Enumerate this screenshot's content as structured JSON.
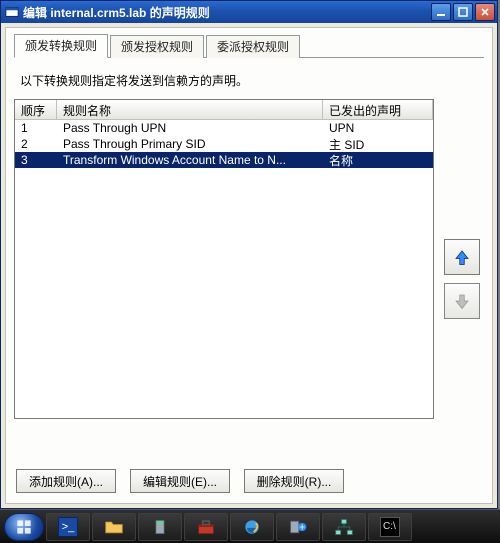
{
  "window": {
    "title": "编辑 internal.crm5.lab 的声明规则"
  },
  "tabs": [
    {
      "label": "颁发转换规则",
      "active": true
    },
    {
      "label": "颁发授权规则",
      "active": false
    },
    {
      "label": "委派授权规则",
      "active": false
    }
  ],
  "description": "以下转换规则指定将发送到信赖方的声明。",
  "list": {
    "headers": {
      "order": "顺序",
      "name": "规则名称",
      "claim": "已发出的声明"
    },
    "rows": [
      {
        "order": "1",
        "name": "Pass Through UPN",
        "claim": "UPN",
        "selected": false
      },
      {
        "order": "2",
        "name": "Pass Through Primary SID",
        "claim": "主 SID",
        "selected": false
      },
      {
        "order": "3",
        "name": "Transform Windows Account Name to N...",
        "claim": "名称",
        "selected": true
      }
    ]
  },
  "buttons": {
    "add": "添加规则(A)...",
    "edit": "编辑规则(E)...",
    "remove": "删除规则(R)..."
  },
  "arrows": {
    "up_enabled": true,
    "down_enabled": false
  }
}
